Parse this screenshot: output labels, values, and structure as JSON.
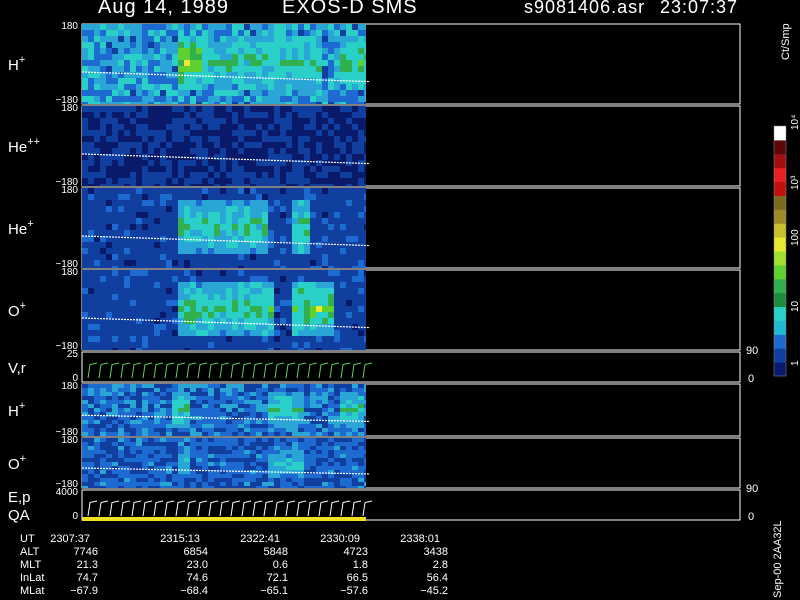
{
  "header": {
    "date": "Aug 14, 1989",
    "instrument": "EXOS-D SMS",
    "filename": "s9081406.asr",
    "time": "23:07:37"
  },
  "colorbar": {
    "unit": "Ct/Smp",
    "ticks": [
      "1",
      "10",
      "100",
      "10³",
      "10⁴"
    ]
  },
  "footer_text": "Sep-00 2AA32L",
  "chart_data": [
    {
      "type": "heatmap",
      "panel": "H+ (upper)",
      "label": "H",
      "sup": "+",
      "ylim": [
        -180,
        180
      ],
      "ytick_top": "180",
      "ytick_bottom": "−180",
      "data_extent_fraction": 0.8
    },
    {
      "type": "heatmap",
      "panel": "He++",
      "label": "He",
      "sup": "++",
      "ylim": [
        -180,
        180
      ],
      "ytick_top": "180",
      "ytick_bottom": "−180"
    },
    {
      "type": "heatmap",
      "panel": "He+",
      "label": "He",
      "sup": "+",
      "ylim": [
        -180,
        180
      ],
      "ytick_top": "180",
      "ytick_bottom": "−180"
    },
    {
      "type": "heatmap",
      "panel": "O+ (upper)",
      "label": "O",
      "sup": "+",
      "ylim": [
        -180,
        180
      ],
      "ytick_top": "180",
      "ytick_bottom": "−180"
    },
    {
      "type": "line",
      "panel": "V,r",
      "label": "V,r",
      "ylim": [
        0,
        25
      ],
      "ytick_top": "25",
      "ytick_bottom": "0",
      "right_ticks": [
        "90",
        "0"
      ]
    },
    {
      "type": "heatmap",
      "panel": "H+ (lower)",
      "label": "H",
      "sup": "+",
      "ylim": [
        -180,
        180
      ],
      "ytick_top": "180",
      "ytick_bottom": "−180"
    },
    {
      "type": "heatmap",
      "panel": "O+ (lower)",
      "label": "O",
      "sup": "+",
      "ylim": [
        -180,
        180
      ],
      "ytick_top": "180",
      "ytick_bottom": "−180"
    },
    {
      "type": "line",
      "panel": "E,p / QA",
      "label": "E,p",
      "label2": "QA",
      "ylim": [
        0,
        4000
      ],
      "ytick_top": "4000",
      "ytick_bottom": "0",
      "right_ticks": [
        "90",
        "0"
      ]
    }
  ],
  "orbit_table": {
    "row_labels": [
      "UT",
      "ALT",
      "MLT",
      "InLat",
      "MLat"
    ],
    "columns": [
      {
        "UT": "2307:37",
        "ALT": "7746",
        "MLT": "21.3",
        "InLat": "74.7",
        "MLat": "−67.9"
      },
      {
        "UT": "2315:13",
        "ALT": "6854",
        "MLT": "23.0",
        "InLat": "74.6",
        "MLat": "−68.4"
      },
      {
        "UT": "2322:41",
        "ALT": "5848",
        "MLT": "0.6",
        "InLat": "72.1",
        "MLat": "−65.1"
      },
      {
        "UT": "2330:09",
        "ALT": "4723",
        "MLT": "1.8",
        "InLat": "66.5",
        "MLat": "−57.6"
      },
      {
        "UT": "2338:01",
        "ALT": "3438",
        "MLT": "2.8",
        "InLat": "56.4",
        "MLat": "−45.2"
      }
    ]
  }
}
